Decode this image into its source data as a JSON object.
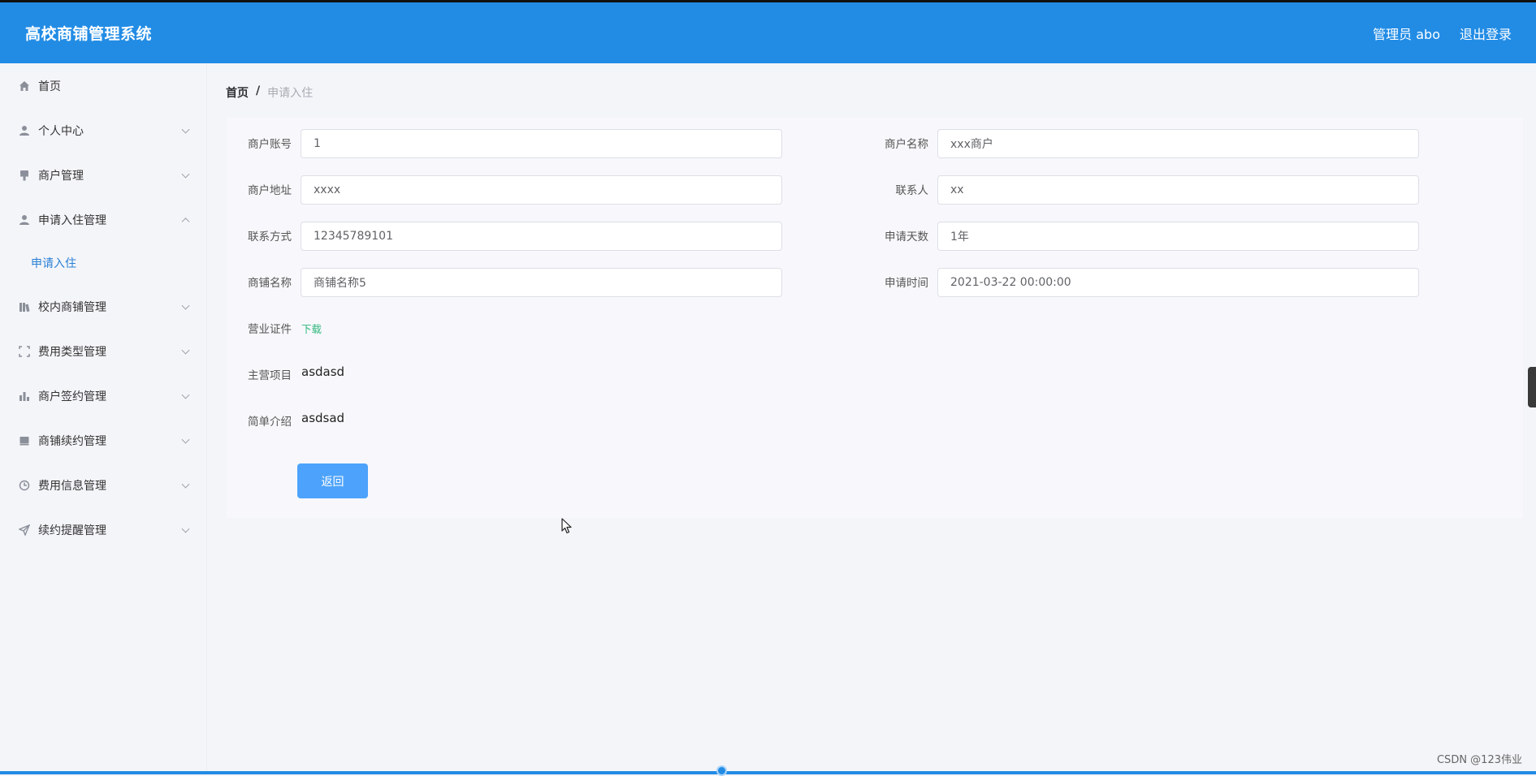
{
  "header": {
    "app_title": "高校商铺管理系统",
    "user_label": "管理员 abo",
    "logout_label": "退出登录"
  },
  "sidebar": {
    "items": [
      {
        "label": "首页",
        "icon": "home-icon"
      },
      {
        "label": "个人中心",
        "icon": "user-icon"
      },
      {
        "label": "商户管理",
        "icon": "brush-icon"
      },
      {
        "label": "申请入住管理",
        "icon": "user-icon"
      },
      {
        "label": "校内商铺管理",
        "icon": "bars-icon"
      },
      {
        "label": "费用类型管理",
        "icon": "fullscreen-icon"
      },
      {
        "label": "商户签约管理",
        "icon": "chart-icon"
      },
      {
        "label": "商铺续约管理",
        "icon": "box-icon"
      },
      {
        "label": "费用信息管理",
        "icon": "clock-icon"
      },
      {
        "label": "续约提醒管理",
        "icon": "send-icon"
      }
    ],
    "sub_item": "申请入住"
  },
  "breadcrumb": {
    "home": "首页",
    "separator": "/",
    "current": "申请入住"
  },
  "form": {
    "merchant_account_label": "商户账号",
    "merchant_account_value": "1",
    "merchant_name_label": "商户名称",
    "merchant_name_value": "xxx商户",
    "merchant_address_label": "商户地址",
    "merchant_address_value": "xxxx",
    "contact_person_label": "联系人",
    "contact_person_value": "xx",
    "contact_method_label": "联系方式",
    "contact_method_value": "12345789101",
    "apply_days_label": "申请天数",
    "apply_days_value": "1年",
    "shop_name_label": "商铺名称",
    "shop_name_value": "商铺名称5",
    "apply_time_label": "申请时间",
    "apply_time_value": "2021-03-22 00:00:00",
    "license_label": "营业证件",
    "license_download": "下载",
    "main_business_label": "主营项目",
    "main_business_value": "asdasd",
    "intro_label": "简单介绍",
    "intro_value": "asdsad",
    "back_button": "返回"
  },
  "watermark": "CSDN @123伟业",
  "colors": {
    "header_bg": "#228ce5",
    "button_bg": "#4da3fb",
    "link_green": "#2fb77c",
    "active_blue": "#2a80d5"
  }
}
